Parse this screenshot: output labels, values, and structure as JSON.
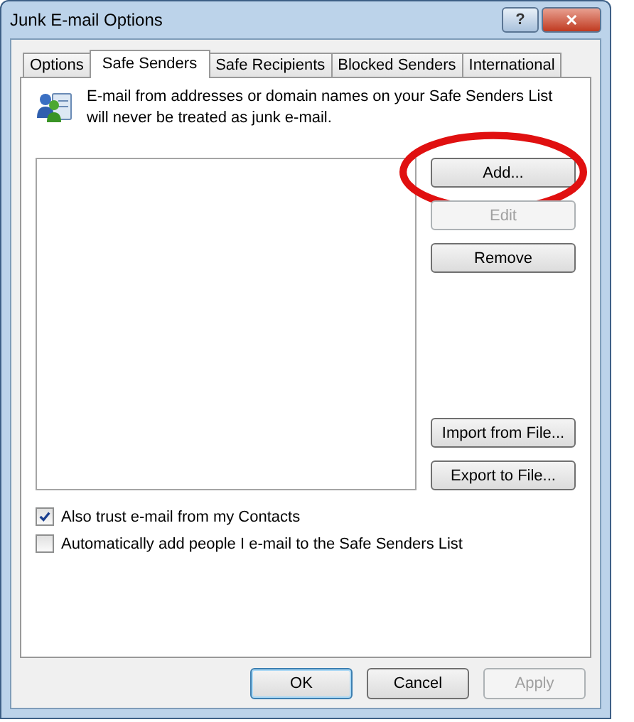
{
  "window": {
    "title": "Junk E-mail Options",
    "controls": [
      {
        "kind": "help",
        "label": "?"
      },
      {
        "kind": "close",
        "label": "✕"
      }
    ]
  },
  "tabs": [
    {
      "label": "Options",
      "selected": false
    },
    {
      "label": "Safe Senders",
      "selected": true
    },
    {
      "label": "Safe Recipients",
      "selected": false
    },
    {
      "label": "Blocked Senders",
      "selected": false
    },
    {
      "label": "International",
      "selected": false
    }
  ],
  "description": "E-mail from addresses or domain names on your Safe Senders List will never be treated as junk e-mail.",
  "side_buttons": [
    {
      "label": "Add...",
      "disabled": false,
      "circled": true
    },
    {
      "label": "Edit",
      "disabled": true,
      "circled": false
    },
    {
      "label": "Remove",
      "disabled": false,
      "circled": false
    }
  ],
  "file_buttons": [
    {
      "label": "Import from File...",
      "disabled": false
    },
    {
      "label": "Export to File...",
      "disabled": false
    }
  ],
  "checkboxes": [
    {
      "label": "Also trust e-mail from my Contacts",
      "checked": true
    },
    {
      "label": "Automatically add people I e-mail to the Safe Senders List",
      "checked": false
    }
  ],
  "footer_buttons": [
    {
      "label": "OK",
      "disabled": false,
      "default": true
    },
    {
      "label": "Cancel",
      "disabled": false,
      "default": false
    },
    {
      "label": "Apply",
      "disabled": true,
      "default": false
    }
  ]
}
